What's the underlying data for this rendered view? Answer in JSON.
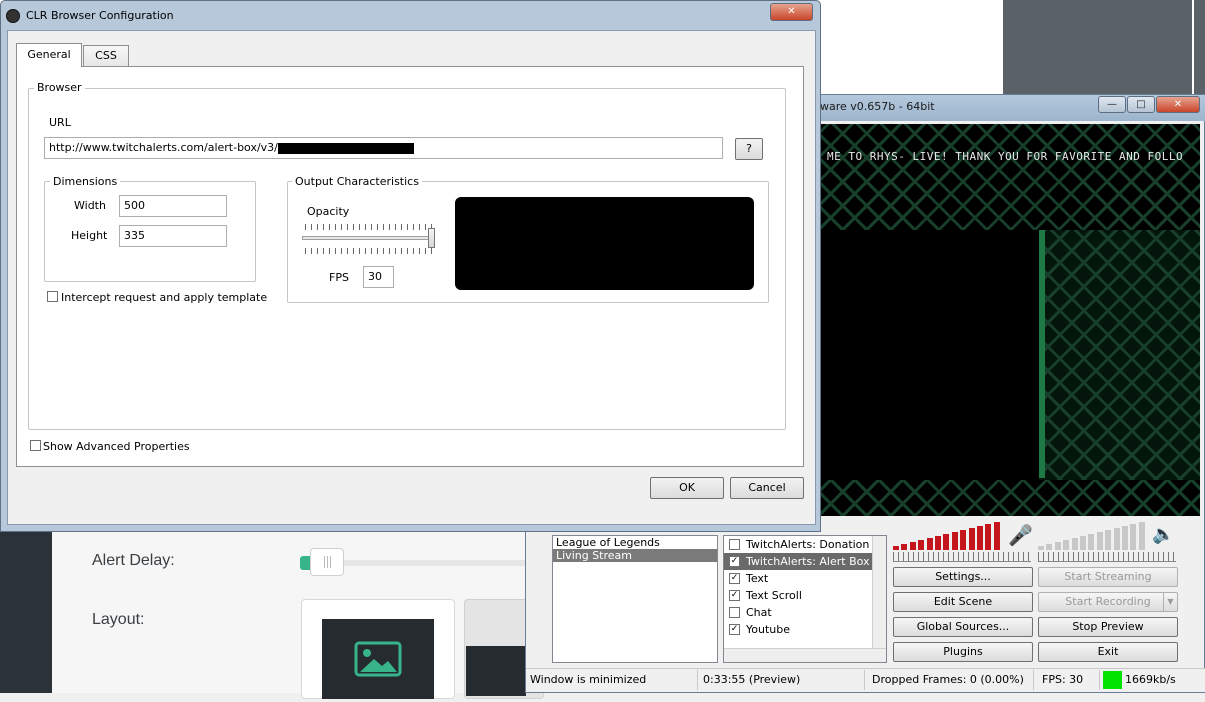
{
  "dialog": {
    "title": "CLR Browser Configuration",
    "close": "✕",
    "tabs": [
      {
        "label": "General"
      },
      {
        "label": "CSS"
      }
    ],
    "browser_group": "Browser",
    "url_label": "URL",
    "url_value": "http://www.twitchalerts.com/alert-box/v3/",
    "help_button": "?",
    "dimensions_group": "Dimensions",
    "width_label": "Width",
    "width_value": "500",
    "height_label": "Height",
    "height_value": "335",
    "intercept_label": "Intercept request and apply template",
    "output_group": "Output Characteristics",
    "opacity_label": "Opacity",
    "opacity_level": 1.0,
    "fps_label": "FPS",
    "fps_value": "30",
    "advanced_label": "Show Advanced Properties",
    "ok": "OK",
    "cancel": "Cancel"
  },
  "obs": {
    "title_fragment": "ware v0.657b - 64bit",
    "ticker_text": "ME TO RHYS- LIVE! THANK YOU FOR FAVORITE AND FOLLO",
    "scenes": [
      {
        "label": "League of Legends",
        "selected": false
      },
      {
        "label": "Living Stream",
        "selected": true
      }
    ],
    "sources": [
      {
        "label": "TwitchAlerts: Donation Go",
        "checked": false,
        "selected": false
      },
      {
        "label": "TwitchAlerts: Alert Box",
        "checked": true,
        "selected": true
      },
      {
        "label": "Text",
        "checked": true,
        "selected": false
      },
      {
        "label": "Text Scroll",
        "checked": true,
        "selected": false
      },
      {
        "label": "Chat",
        "checked": false,
        "selected": false
      },
      {
        "label": "Youtube",
        "checked": true,
        "selected": false
      }
    ],
    "buttons": {
      "settings": "Settings...",
      "start_streaming": "Start Streaming",
      "edit_scene": "Edit Scene",
      "start_recording": "Start Recording",
      "global_sources": "Global Sources...",
      "stop_preview": "Stop Preview",
      "plugins": "Plugins",
      "exit": "Exit"
    },
    "status": {
      "window": "Window is minimized",
      "time": "0:33:55 (Preview)",
      "dropped": "Dropped Frames: 0 (0.00%)",
      "fps": "FPS: 30",
      "bitrate": "1669kb/s"
    },
    "colors": {
      "meter_active": "#c4161c",
      "meter_idle": "#c8c8c8",
      "bitrate_indicator": "#00e400"
    }
  },
  "web": {
    "alert_delay_label": "Alert Delay:",
    "layout_label": "Layout:",
    "accent": "#38b48b"
  }
}
